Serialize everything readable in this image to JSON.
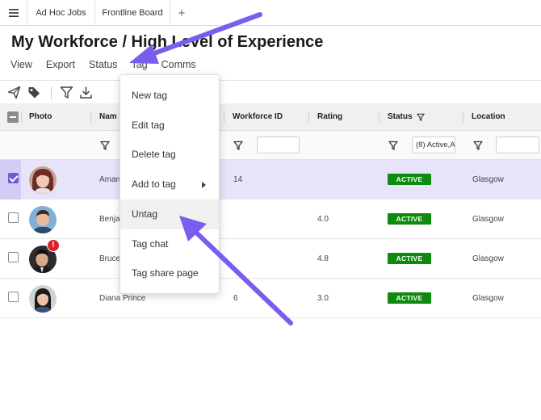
{
  "tabs": {
    "items": [
      {
        "label": "Ad Hoc Jobs"
      },
      {
        "label": "Frontline Board"
      }
    ],
    "add_label": "+"
  },
  "page": {
    "title": "My Workforce / High Level of Experience"
  },
  "menubar": {
    "items": [
      {
        "label": "View"
      },
      {
        "label": "Export"
      },
      {
        "label": "Status"
      },
      {
        "label": "Tag"
      },
      {
        "label": "Comms"
      }
    ]
  },
  "toolbar": {
    "icons": [
      "send-icon",
      "tag-icon",
      "filter-icon",
      "download-icon"
    ]
  },
  "grid": {
    "columns": [
      {
        "label": "Photo"
      },
      {
        "label": "Nam"
      },
      {
        "label": "Workforce ID"
      },
      {
        "label": "Rating"
      },
      {
        "label": "Status"
      },
      {
        "label": "Location"
      }
    ],
    "filters": {
      "status_value": "(8) Active,A"
    },
    "rows": [
      {
        "name": "Aman",
        "workforce_id": "14",
        "rating": "",
        "status": "ACTIVE",
        "location": "Glasgow",
        "selected": true
      },
      {
        "name": "Benja",
        "workforce_id": "",
        "rating": "4.0",
        "status": "ACTIVE",
        "location": "Glasgow",
        "selected": false
      },
      {
        "name": "Bruce",
        "workforce_id": "",
        "rating": "4.8",
        "status": "ACTIVE",
        "location": "Glasgow",
        "selected": false,
        "alert": "!"
      },
      {
        "name": "Diana Prince",
        "workforce_id": "6",
        "rating": "3.0",
        "status": "ACTIVE",
        "location": "Glasgow",
        "selected": false
      }
    ]
  },
  "tag_menu": {
    "items": [
      {
        "label": "New tag"
      },
      {
        "label": "Edit tag"
      },
      {
        "label": "Delete tag"
      },
      {
        "label": "Add to tag"
      },
      {
        "label": "Untag"
      },
      {
        "label": "Tag chat"
      },
      {
        "label": "Tag share page"
      }
    ],
    "hovered": "Untag"
  },
  "colors": {
    "accent": "#6d5bd6",
    "selected_row": "#e7e4f9",
    "active_badge": "#0e8a0e",
    "alert": "#d8232a",
    "annotation_arrow": "#7b5cf0"
  }
}
